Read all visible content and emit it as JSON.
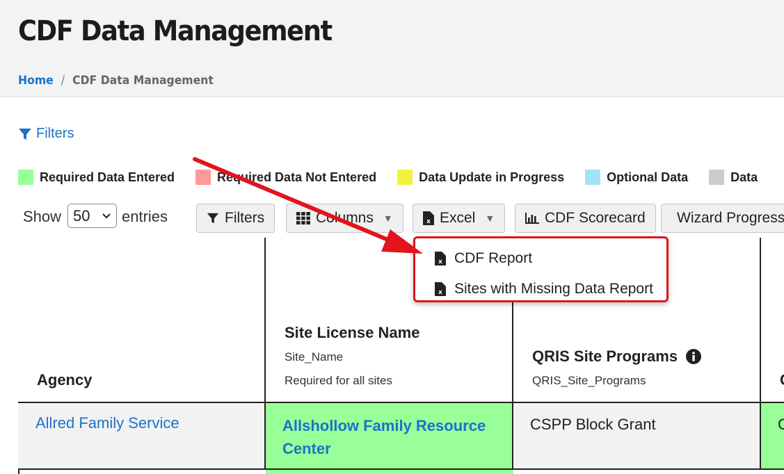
{
  "header": {
    "title": "CDF Data Management"
  },
  "breadcrumb": {
    "home": "Home",
    "separator": "/",
    "current": "CDF Data Management"
  },
  "filters_link": {
    "label": "Filters",
    "icon": "filter-icon"
  },
  "legend": [
    {
      "label": "Required Data Entered",
      "color": "#99ff99"
    },
    {
      "label": "Required Data Not Entered",
      "color": "#ff9a9a"
    },
    {
      "label": "Data Update in Progress",
      "color": "#f2f23d"
    },
    {
      "label": "Optional Data",
      "color": "#a6e1fa"
    },
    {
      "label": "Data",
      "color": "#cccccc"
    }
  ],
  "toolbar": {
    "show_label": "Show",
    "entries_value": "50",
    "entries_label": "entries",
    "filters_button": "Filters",
    "columns_button": "Columns",
    "excel_button": "Excel",
    "scorecard_button": "CDF Scorecard",
    "wizard_button": "Wizard Progress"
  },
  "excel_menu": {
    "items": [
      "CDF Report",
      "Sites with Missing Data Report"
    ]
  },
  "table": {
    "columns": [
      {
        "title": "Agency",
        "field": "",
        "note": ""
      },
      {
        "title": "Site License Name",
        "field": "Site_Name",
        "note": "Required for all sites"
      },
      {
        "title": "QRIS Site Programs",
        "field": "QRIS_Site_Programs",
        "note": ""
      },
      {
        "title": "C",
        "field": "",
        "note": ""
      }
    ],
    "rows": [
      {
        "agency": "Allred Family Service",
        "site_name": "Allshollow Family Resource Center",
        "qris_programs": "CSPP Block Grant",
        "next": "C"
      }
    ]
  },
  "colors": {
    "link": "#1a73c9",
    "highlight_green": "#99ff99",
    "callout_red": "#e2141c",
    "header_bg": "#f2f3f5"
  }
}
